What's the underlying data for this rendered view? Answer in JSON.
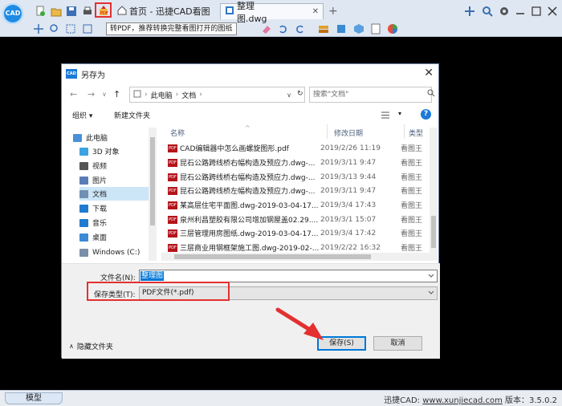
{
  "app": {
    "logo_text": "CAD",
    "tabs": [
      {
        "label": "首页 - 迅捷CAD看图"
      },
      {
        "label": "整理图.dwg",
        "close": "✕"
      }
    ],
    "add_tab": "+",
    "tooltip": "转PDF，推荐转换完整看图打开的图纸"
  },
  "dialog": {
    "icon_text": "CAD",
    "title": "另存为",
    "close": "✕",
    "breadcrumb": [
      "此电脑",
      "文档"
    ],
    "search_placeholder": "搜索\"文档\"",
    "toolbar": {
      "organize": "组织 ▾",
      "new_folder": "新建文件夹",
      "help": "?"
    },
    "nav": [
      {
        "label": "此电脑",
        "icon": "computer-icon",
        "color": "#4a8fd8"
      },
      {
        "label": "3D 对象",
        "icon": "cube-icon",
        "color": "#3aa3e0"
      },
      {
        "label": "视频",
        "icon": "video-icon",
        "color": "#555555"
      },
      {
        "label": "图片",
        "icon": "picture-icon",
        "color": "#5b7db5"
      },
      {
        "label": "文档",
        "icon": "document-icon",
        "color": "#6f8fb3"
      },
      {
        "label": "下载",
        "icon": "download-icon",
        "color": "#1f7ad0"
      },
      {
        "label": "音乐",
        "icon": "music-icon",
        "color": "#1f7ad0"
      },
      {
        "label": "桌面",
        "icon": "desktop-icon",
        "color": "#3a8ad4"
      },
      {
        "label": "Windows (C:)",
        "icon": "drive-icon",
        "color": "#7a8ea8"
      }
    ],
    "columns": {
      "name": "名称",
      "date": "修改日期",
      "type": "类型"
    },
    "files": [
      {
        "name": "CAD编辑器中怎么画螺旋图形.pdf",
        "date": "2019/2/26 11:19",
        "type": "看图王"
      },
      {
        "name": "昆石公路跨线桥右幅构造及预应力.dwg-...",
        "date": "2019/3/11 9:47",
        "type": "看图王"
      },
      {
        "name": "昆石公路跨线桥右幅构造及预应力.dwg-...",
        "date": "2019/3/13 9:44",
        "type": "看图王"
      },
      {
        "name": "昆石公路跨线桥左幅构造及预应力.dwg-...",
        "date": "2019/3/11 9:47",
        "type": "看图王"
      },
      {
        "name": "某高层住宅平面图.dwg-2019-03-04-17...",
        "date": "2019/3/4 17:43",
        "type": "看图王"
      },
      {
        "name": "泉州利昌塑胶有限公司增加钢屋盖02.29....",
        "date": "2019/3/1 15:07",
        "type": "看图王"
      },
      {
        "name": "三层管理用房图纸.dwg-2019-03-04-17...",
        "date": "2019/3/4 17:42",
        "type": "看图王"
      },
      {
        "name": "三层商业用钢框架施工图.dwg-2019-02-...",
        "date": "2019/2/22 16:32",
        "type": "看图王"
      }
    ],
    "file_icon_text": "PDF",
    "filename_label": "文件名(N):",
    "filename_value": "整理图",
    "savetype_label": "保存类型(T):",
    "savetype_value": "PDF文件(*.pdf)",
    "hide_folders": "隐藏文件夹",
    "save_button": "保存(S)",
    "cancel_button": "取消"
  },
  "status": {
    "model_tab": "模型",
    "brand": "迅捷CAD: ",
    "url": "www.xunjiecad.com",
    "version": " 版本：3.5.0.2"
  },
  "colors": {
    "highlight": "#e43030",
    "accent": "#0078d7"
  }
}
